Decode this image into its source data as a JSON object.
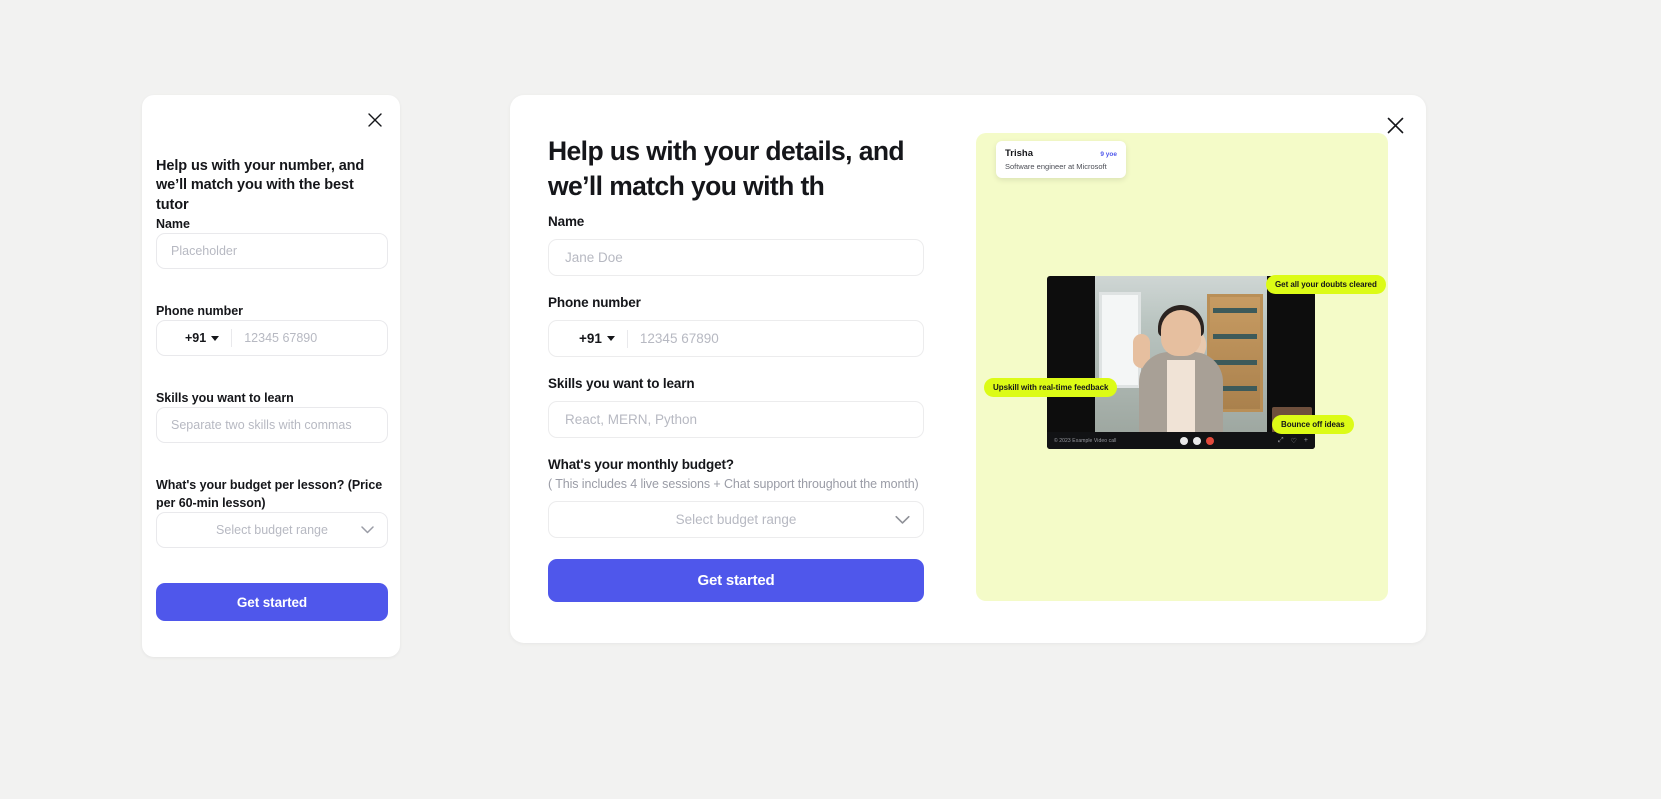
{
  "page": {
    "background_color": "#f2f2f1",
    "accent_color": "#4f57eb",
    "highlight_color": "#dcfb16",
    "panel_color": "#f4fbc8"
  },
  "left_modal": {
    "close_icon": "close-icon",
    "title": "Help us with your number, and we’ll match you with the best tutor",
    "fields": {
      "name": {
        "label": "Name",
        "placeholder": "Placeholder",
        "value": ""
      },
      "phone": {
        "label": "Phone number",
        "country_code": "+91",
        "placeholder": "12345 67890",
        "value": ""
      },
      "skills": {
        "label": "Skills you want to learn",
        "placeholder": "Separate two skills with commas",
        "value": ""
      },
      "budget": {
        "label": "What's your budget per lesson? (Price per 60-min lesson)",
        "placeholder": "Select budget range",
        "value": ""
      }
    },
    "cta_label": "Get started"
  },
  "main_modal": {
    "close_icon": "close-icon",
    "title": "Help us with your details, and we’ll match you with th",
    "fields": {
      "name": {
        "label": "Name",
        "placeholder": "Jane Doe",
        "value": ""
      },
      "phone": {
        "label": "Phone number",
        "country_code": "+91",
        "placeholder": "12345 67890",
        "value": ""
      },
      "skills": {
        "label": "Skills you want to learn",
        "placeholder": "React, MERN, Python",
        "value": ""
      },
      "budget": {
        "label": "What's your monthly budget?",
        "sublabel": "( This includes 4 live sessions + Chat support throughout the month)",
        "placeholder": "Select budget range",
        "value": ""
      }
    },
    "cta_label": "Get started"
  },
  "illustration": {
    "tutor_card": {
      "name": "Trisha",
      "experience_badge": "9 yoe",
      "role": "Software engineer at Microsoft"
    },
    "pills": [
      {
        "id": "doubts",
        "text": "Get all your doubts cleared"
      },
      {
        "id": "upskill",
        "text": "Upskill with real-time feedback"
      },
      {
        "id": "bounce",
        "text": "Bounce off ideas"
      }
    ],
    "video_controls": {
      "brand": "© 2023 Example Video call",
      "mic_icon": "mic-icon",
      "camera_icon": "camera-icon",
      "end_call_icon": "end-call-icon",
      "expand_icon": "expand-icon",
      "chat_icon": "chat-icon",
      "add_icon": "add-icon"
    }
  }
}
